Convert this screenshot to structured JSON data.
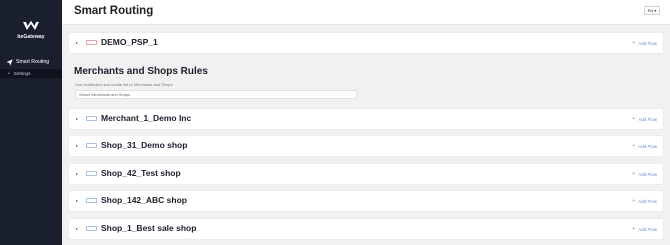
{
  "sidebar": {
    "logo_text": "beGateway",
    "nav_active": {
      "label": "Smart Routing",
      "icon": "send-icon"
    },
    "nav_sub": {
      "label": "Settings"
    }
  },
  "header": {
    "title": "Smart Routing",
    "lang": "EN ▾"
  },
  "psp_card": {
    "title": "DEMO_PSP_1",
    "add_flow": "Add Flow"
  },
  "section": {
    "title": "Merchants and Shops Rules",
    "description": "Use multiselect and create list of Merchants and Shops",
    "select_placeholder": "Select Merchants and Shops"
  },
  "cards": [
    {
      "title": "Merchant_1_Demo Inc",
      "add_flow": "Add Flow"
    },
    {
      "title": "Shop_31_Demo shop",
      "add_flow": "Add Flow"
    },
    {
      "title": "Shop_42_Test shop",
      "add_flow": "Add Flow"
    },
    {
      "title": "Shop_142_ABC shop",
      "add_flow": "Add Flow"
    },
    {
      "title": "Shop_1_Best sale shop",
      "add_flow": "Add Flow"
    }
  ],
  "colors": {
    "sidebar_bg": "#1a1f2e",
    "accent_link": "#6a8fd0"
  }
}
